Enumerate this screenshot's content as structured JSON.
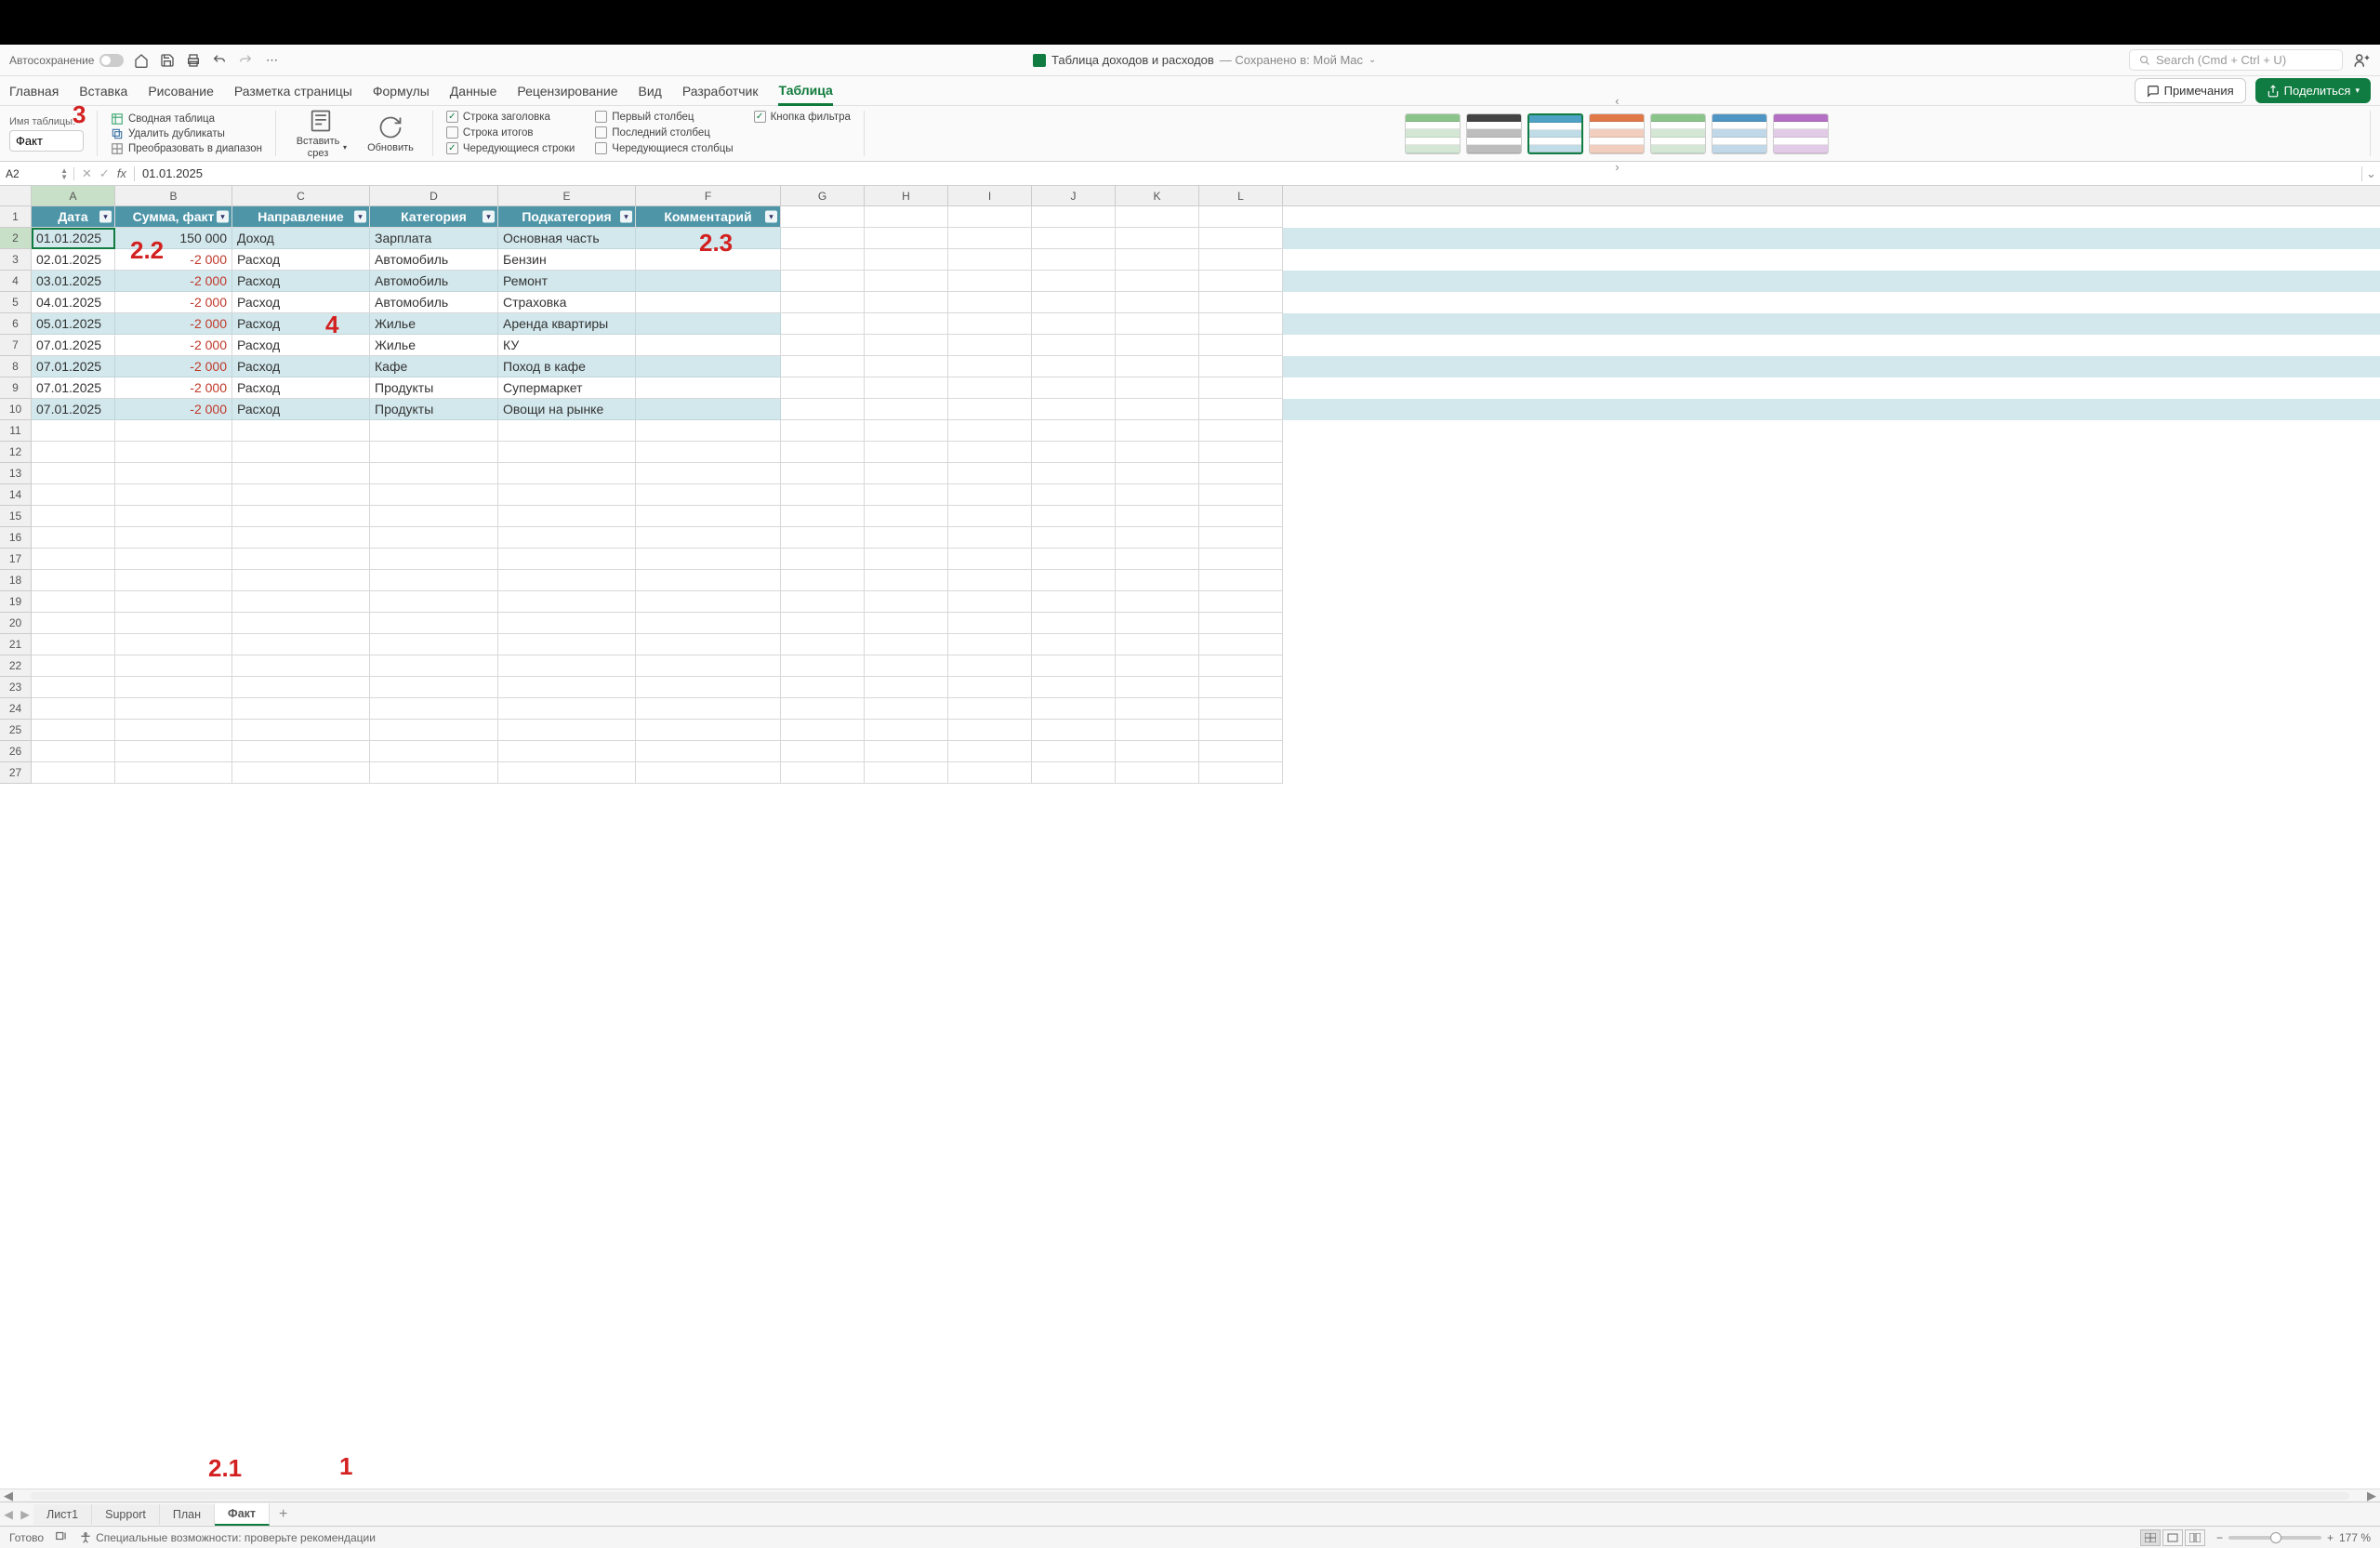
{
  "titlebar": {
    "autosave": "Автосохранение",
    "doc_name": "Таблица доходов и расходов",
    "doc_sub": "— Сохранено в: Мой Mac",
    "search_placeholder": "Search (Cmd + Ctrl + U)"
  },
  "ribbon": {
    "tabs": [
      "Главная",
      "Вставка",
      "Рисование",
      "Разметка страницы",
      "Формулы",
      "Данные",
      "Рецензирование",
      "Вид",
      "Разработчик",
      "Таблица"
    ],
    "active_tab": "Таблица",
    "comments_btn": "Примечания",
    "share_btn": "Поделиться",
    "table_name_label": "Имя таблицы:",
    "table_name_value": "Факт",
    "tools": {
      "pivot": "Сводная таблица",
      "dupes": "Удалить дубликаты",
      "to_range": "Преобразовать в диапазон"
    },
    "insert_slicer": "Вставить срез",
    "refresh": "Обновить",
    "options": {
      "header_row": "Строка заголовка",
      "total_row": "Строка итогов",
      "banded_rows": "Чередующиеся строки",
      "first_col": "Первый столбец",
      "last_col": "Последний столбец",
      "banded_cols": "Чередующиеся столбцы",
      "filter_btn": "Кнопка фильтра"
    }
  },
  "name_box": "A2",
  "formula_value": "01.01.2025",
  "columns": [
    {
      "letter": "A",
      "width": 90
    },
    {
      "letter": "B",
      "width": 126
    },
    {
      "letter": "C",
      "width": 148
    },
    {
      "letter": "D",
      "width": 138
    },
    {
      "letter": "E",
      "width": 148
    },
    {
      "letter": "F",
      "width": 156
    },
    {
      "letter": "G",
      "width": 90
    },
    {
      "letter": "H",
      "width": 90
    },
    {
      "letter": "I",
      "width": 90
    },
    {
      "letter": "J",
      "width": 90
    },
    {
      "letter": "K",
      "width": 90
    },
    {
      "letter": "L",
      "width": 90
    }
  ],
  "headers": [
    "Дата",
    "Сумма, факт",
    "Направление",
    "Категория",
    "Подкатегория",
    "Комментарий"
  ],
  "rows": [
    {
      "n": 1
    },
    {
      "n": 2,
      "data": [
        "01.01.2025",
        "150 000",
        "Доход",
        "Зарплата",
        "Основная часть",
        ""
      ],
      "neg": false,
      "band": true,
      "sel": true
    },
    {
      "n": 3,
      "data": [
        "02.01.2025",
        "-2 000",
        "Расход",
        "Автомобиль",
        "Бензин",
        ""
      ],
      "neg": true,
      "band": false
    },
    {
      "n": 4,
      "data": [
        "03.01.2025",
        "-2 000",
        "Расход",
        "Автомобиль",
        "Ремонт",
        ""
      ],
      "neg": true,
      "band": true
    },
    {
      "n": 5,
      "data": [
        "04.01.2025",
        "-2 000",
        "Расход",
        "Автомобиль",
        "Страховка",
        ""
      ],
      "neg": true,
      "band": false
    },
    {
      "n": 6,
      "data": [
        "05.01.2025",
        "-2 000",
        "Расход",
        "Жилье",
        "Аренда квартиры",
        ""
      ],
      "neg": true,
      "band": true
    },
    {
      "n": 7,
      "data": [
        "07.01.2025",
        "-2 000",
        "Расход",
        "Жилье",
        "КУ",
        ""
      ],
      "neg": true,
      "band": false
    },
    {
      "n": 8,
      "data": [
        "07.01.2025",
        "-2 000",
        "Расход",
        "Кафе",
        "Поход в кафе",
        ""
      ],
      "neg": true,
      "band": true
    },
    {
      "n": 9,
      "data": [
        "07.01.2025",
        "-2 000",
        "Расход",
        "Продукты",
        "Супермаркет",
        ""
      ],
      "neg": true,
      "band": false
    },
    {
      "n": 10,
      "data": [
        "07.01.2025",
        "-2 000",
        "Расход",
        "Продукты",
        "Овощи на рынке",
        ""
      ],
      "neg": true,
      "band": true
    }
  ],
  "empty_rows": 17,
  "sheets": [
    "Лист1",
    "Support",
    "План",
    "Факт"
  ],
  "active_sheet": "Факт",
  "status": {
    "ready": "Готово",
    "a11y": "Специальные возможности: проверьте рекомендации",
    "zoom": "177 %"
  },
  "annotations": {
    "a3": "3",
    "a2_2": "2.2",
    "a2_3": "2.3",
    "a4": "4",
    "a2_1": "2.1",
    "a1": "1"
  },
  "style_colors": [
    "#8bc48b",
    "#444444",
    "#4ea2c4",
    "#e07848",
    "#8bc48b",
    "#4e95c4",
    "#b470c4"
  ]
}
